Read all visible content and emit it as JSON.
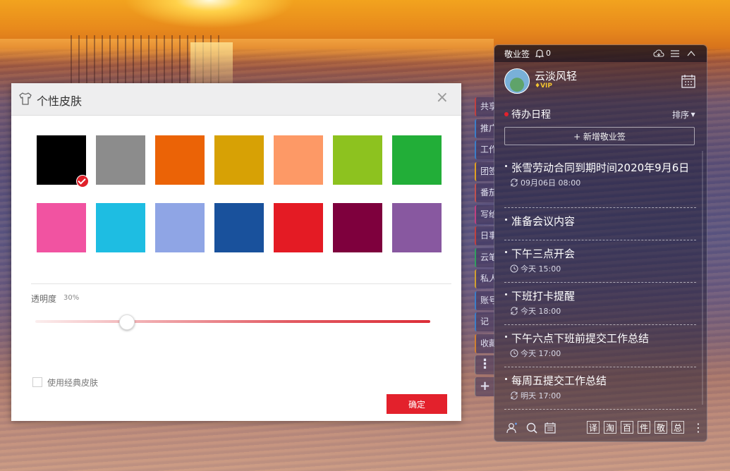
{
  "dialog": {
    "title": "个性皮肤",
    "close_label": "×",
    "swatches": [
      {
        "color": "#000000",
        "selected": true
      },
      {
        "color": "#8c8c8c",
        "selected": false
      },
      {
        "color": "#eb6306",
        "selected": false
      },
      {
        "color": "#d7a105",
        "selected": false
      },
      {
        "color": "#fd9966",
        "selected": false
      },
      {
        "color": "#8dc21f",
        "selected": false
      },
      {
        "color": "#22ae38",
        "selected": false
      },
      {
        "color": "#f153a1",
        "selected": false
      },
      {
        "color": "#1ebde2",
        "selected": false
      },
      {
        "color": "#8fa5e5",
        "selected": false
      },
      {
        "color": "#19519c",
        "selected": false
      },
      {
        "color": "#e41b24",
        "selected": false
      },
      {
        "color": "#7e003d",
        "selected": false
      },
      {
        "color": "#8858a0",
        "selected": false
      }
    ],
    "opacity_label": "透明度",
    "opacity_value": "30%",
    "opacity_fraction": 0.23,
    "classic_skin_label": "使用经典皮肤",
    "classic_skin_checked": false,
    "confirm_label": "确定"
  },
  "side_tabs": [
    {
      "label": "共享"
    },
    {
      "label": "推广"
    },
    {
      "label": "工作"
    },
    {
      "label": "团签"
    },
    {
      "label": "番茄"
    },
    {
      "label": "写给"
    },
    {
      "label": "日事"
    },
    {
      "label": "云笔"
    },
    {
      "label": "私人"
    },
    {
      "label": "账号"
    },
    {
      "label": "记"
    },
    {
      "label": "收藏"
    },
    {
      "label": "⋮"
    },
    {
      "label": "+"
    }
  ],
  "widget": {
    "app_name": "敬业签",
    "bell_count": "0",
    "user_name": "云淡风轻",
    "vip_label": "VIP",
    "section_title": "待办日程",
    "sort_label": "排序",
    "add_label": "+ 新增敬业签",
    "items": [
      {
        "title": "张雪劳动合同到期时间2020年9月6日",
        "icon": "repeat-icon",
        "date": "09月06日",
        "time": "08:00"
      },
      {
        "title": "准备会议内容",
        "icon": "",
        "date": "",
        "time": ""
      },
      {
        "title": "下午三点开会",
        "icon": "clock-icon",
        "date": "今天",
        "time": "15:00"
      },
      {
        "title": "下班打卡提醒",
        "icon": "repeat-icon",
        "date": "今天",
        "time": "18:00"
      },
      {
        "title": "下午六点下班前提交工作总结",
        "icon": "clock-icon",
        "date": "今天",
        "time": "17:00"
      },
      {
        "title": "每周五提交工作总结",
        "icon": "repeat-icon",
        "date": "明天",
        "time": "17:00"
      }
    ],
    "tools": [
      "译",
      "淘",
      "百",
      "件",
      "敬",
      "总"
    ],
    "more_label": "⋮"
  }
}
